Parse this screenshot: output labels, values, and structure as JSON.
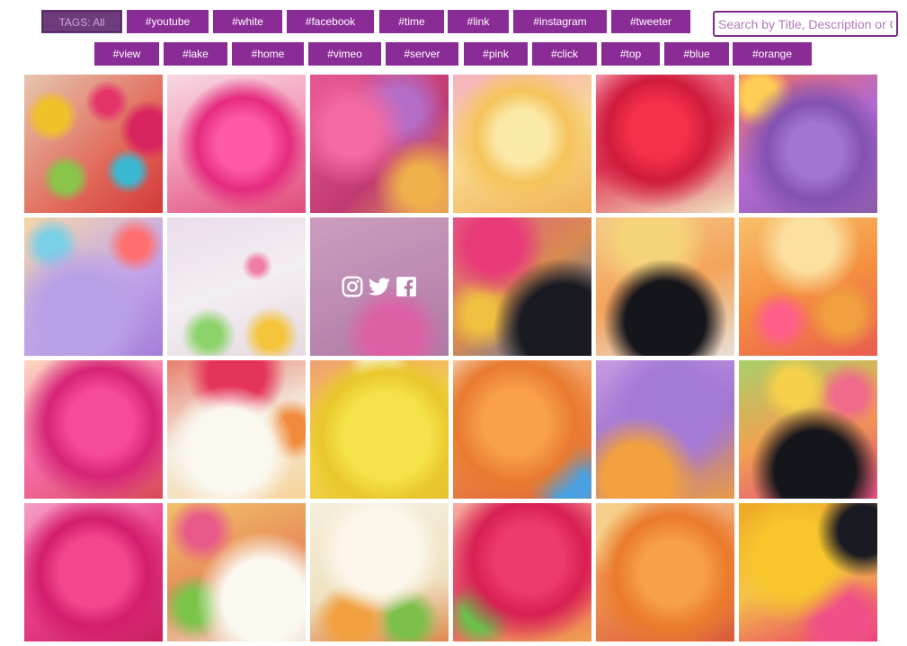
{
  "tags_row1": [
    {
      "label": "TAGS: All",
      "active": true
    },
    {
      "label": "#youtube"
    },
    {
      "label": "#white"
    },
    {
      "label": "#facebook"
    },
    {
      "label": "#time"
    },
    {
      "label": "#link"
    },
    {
      "label": "#instagram"
    },
    {
      "label": "#tweeter"
    }
  ],
  "tags_row2": [
    {
      "label": "#view"
    },
    {
      "label": "#lake"
    },
    {
      "label": "#home"
    },
    {
      "label": "#vimeo"
    },
    {
      "label": "#server"
    },
    {
      "label": "#pink"
    },
    {
      "label": "#click"
    },
    {
      "label": "#top"
    },
    {
      "label": "#blue"
    },
    {
      "label": "#orange"
    }
  ],
  "search": {
    "placeholder": "Search by Title, Description or Category"
  },
  "hover_icons": [
    "instagram-icon",
    "twitter-icon",
    "facebook-icon"
  ],
  "colors": {
    "tag_bg": "#8a2c96",
    "tag_active_bg": "#6e3b7d",
    "search_border": "#7c2b8b"
  },
  "tiles": [
    {
      "theme": "sprinkles-mix"
    },
    {
      "theme": "pink-raspberry"
    },
    {
      "theme": "pink-purple-blur"
    },
    {
      "theme": "yellow-gummy"
    },
    {
      "theme": "red-raspberry"
    },
    {
      "theme": "purple-gummy"
    },
    {
      "theme": "purple-sprinkles"
    },
    {
      "theme": "white-sprinkles"
    },
    {
      "theme": "mauve-hover",
      "hovered": true
    },
    {
      "theme": "blackberry-left"
    },
    {
      "theme": "blackberry-yellow"
    },
    {
      "theme": "orange-sprinkles"
    },
    {
      "theme": "pink-raspberry-2"
    },
    {
      "theme": "white-gummy"
    },
    {
      "theme": "yellow-sprinkles"
    },
    {
      "theme": "orange-blur"
    },
    {
      "theme": "purple-orange"
    },
    {
      "theme": "blackberry-sprinkles"
    },
    {
      "theme": "pink-raspberry-3"
    },
    {
      "theme": "white-heart"
    },
    {
      "theme": "cream-sprinkles"
    },
    {
      "theme": "red-raspberry-2"
    },
    {
      "theme": "orange-gummy"
    },
    {
      "theme": "yellow-blackberry"
    }
  ]
}
